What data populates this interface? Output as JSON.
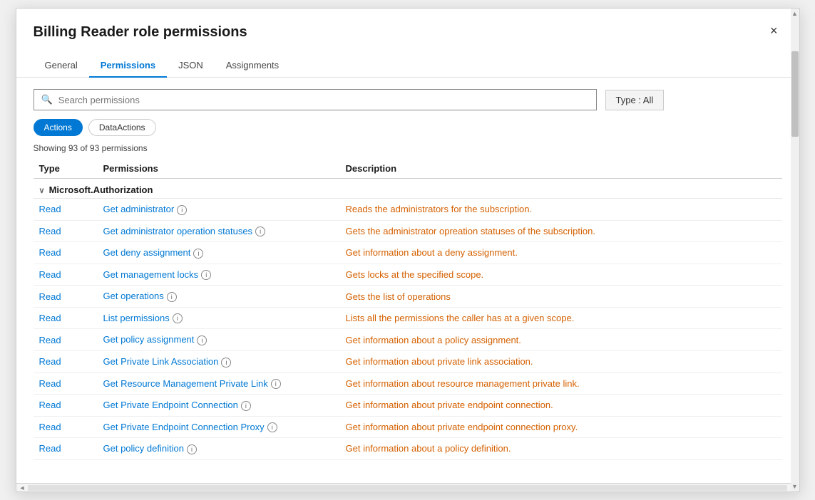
{
  "dialog": {
    "title": "Billing Reader role permissions",
    "close_label": "×"
  },
  "tabs": [
    {
      "id": "general",
      "label": "General",
      "active": false
    },
    {
      "id": "permissions",
      "label": "Permissions",
      "active": true
    },
    {
      "id": "json",
      "label": "JSON",
      "active": false
    },
    {
      "id": "assignments",
      "label": "Assignments",
      "active": false
    }
  ],
  "search": {
    "placeholder": "Search permissions"
  },
  "type_button": {
    "label": "Type : All"
  },
  "pills": [
    {
      "id": "actions",
      "label": "Actions",
      "active": true
    },
    {
      "id": "dataactions",
      "label": "DataActions",
      "active": false
    }
  ],
  "showing_text": "Showing 93 of 93 permissions",
  "columns": {
    "type": "Type",
    "permissions": "Permissions",
    "description": "Description"
  },
  "groups": [
    {
      "name": "Microsoft.Authorization",
      "rows": [
        {
          "type": "Read",
          "permission": "Get administrator",
          "has_info": true,
          "description": "Reads the administrators for the subscription."
        },
        {
          "type": "Read",
          "permission": "Get administrator operation statuses",
          "has_info": true,
          "description": "Gets the administrator opreation statuses of the subscription."
        },
        {
          "type": "Read",
          "permission": "Get deny assignment",
          "has_info": true,
          "description": "Get information about a deny assignment."
        },
        {
          "type": "Read",
          "permission": "Get management locks",
          "has_info": true,
          "description": "Gets locks at the specified scope."
        },
        {
          "type": "Read",
          "permission": "Get operations",
          "has_info": true,
          "description": "Gets the list of operations"
        },
        {
          "type": "Read",
          "permission": "List permissions",
          "has_info": true,
          "description": "Lists all the permissions the caller has at a given scope."
        },
        {
          "type": "Read",
          "permission": "Get policy assignment",
          "has_info": true,
          "description": "Get information about a policy assignment."
        },
        {
          "type": "Read",
          "permission": "Get Private Link Association",
          "has_info": true,
          "description": "Get information about private link association."
        },
        {
          "type": "Read",
          "permission": "Get Resource Management Private Link",
          "has_info": true,
          "description": "Get information about resource management private link."
        },
        {
          "type": "Read",
          "permission": "Get Private Endpoint Connection",
          "has_info": true,
          "description": "Get information about private endpoint connection."
        },
        {
          "type": "Read",
          "permission": "Get Private Endpoint Connection Proxy",
          "has_info": true,
          "description": "Get information about private endpoint connection proxy."
        },
        {
          "type": "Read",
          "permission": "Get policy definition",
          "has_info": true,
          "description": "Get information about a policy definition."
        }
      ]
    }
  ]
}
